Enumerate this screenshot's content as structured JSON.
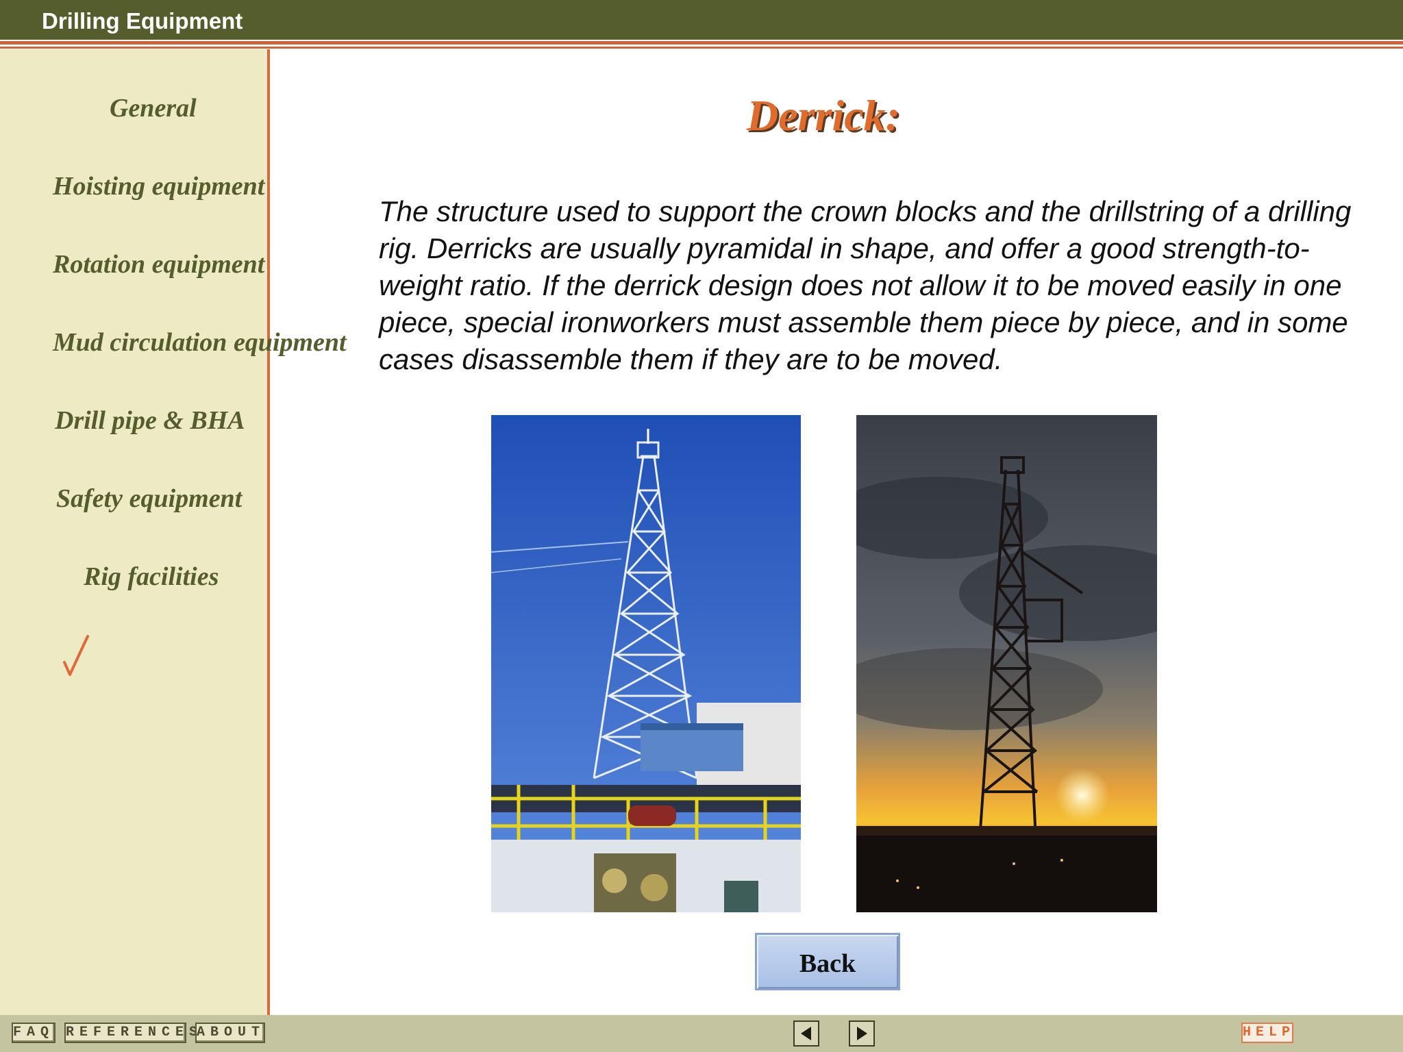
{
  "header": {
    "title": "Drilling Equipment"
  },
  "sidebar": {
    "items": [
      {
        "label": "General"
      },
      {
        "label": "Hoisting equipment"
      },
      {
        "label": "Rotation equipment"
      },
      {
        "label": "Mud circulation equipment"
      },
      {
        "label": "Drill pipe & BHA"
      },
      {
        "label": "Safety equipment"
      },
      {
        "label": "Rig facilities"
      }
    ],
    "checkmark_icon": "checkmark-icon"
  },
  "main": {
    "title": "Derrick:",
    "description": "The structure used to support the crown blocks and the drillstring of a drilling rig. Derricks are usually pyramidal in shape, and offer a good strength-to-weight ratio. If the derrick design does not allow it to be moved easily in one piece, special ironworkers must assemble them piece by piece, and in some cases disassemble them if they are to be moved.",
    "back_label": "Back"
  },
  "footer": {
    "faq_label": "FAQ",
    "references_label": "REFERENCES",
    "about_label": "ABOUT",
    "help_label": "HELP",
    "prev_icon": "triangle-left-icon",
    "next_icon": "triangle-right-icon"
  },
  "colors": {
    "header_bg": "#545d2b",
    "accent": "#d96a3a",
    "sidebar_bg": "#eeebc4",
    "nav_text": "#545d2b",
    "title": "#e06b2c",
    "footer_bg": "#c5c4a0"
  }
}
